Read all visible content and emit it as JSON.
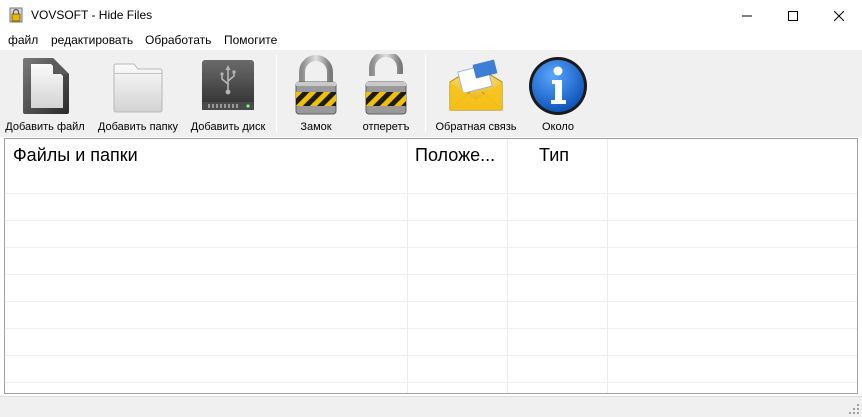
{
  "window": {
    "title": "VOVSOFT - Hide Files",
    "app_icon": "lock-app-icon",
    "controls": {
      "minimize": "minimize-icon",
      "maximize": "maximize-icon",
      "close": "close-icon"
    }
  },
  "menu": {
    "items": [
      {
        "label": "файл"
      },
      {
        "label": "редактировать"
      },
      {
        "label": "Обработать"
      },
      {
        "label": "Помогите"
      }
    ]
  },
  "toolbar": {
    "buttons": [
      {
        "label": "Добавить файл",
        "icon": "file-icon"
      },
      {
        "label": "Добавить папку",
        "icon": "folder-icon"
      },
      {
        "label": "Добавить диск",
        "icon": "usb-drive-icon"
      },
      {
        "label": "Замок",
        "icon": "padlock-closed-icon"
      },
      {
        "label": "отперетъ",
        "icon": "padlock-open-icon"
      },
      {
        "label": "Обратная связь",
        "icon": "envelope-icon"
      },
      {
        "label": "Около",
        "icon": "info-icon"
      }
    ]
  },
  "list": {
    "columns": [
      {
        "label": "Файлы и папки"
      },
      {
        "label": "Положе..."
      },
      {
        "label": "Тип"
      }
    ],
    "rows": []
  },
  "colors": {
    "toolbar_bg": "#f0f0f0",
    "info_blue": "#1a6fd0",
    "envelope_yellow": "#f5c518",
    "lock_stripe": "#f2c000"
  }
}
